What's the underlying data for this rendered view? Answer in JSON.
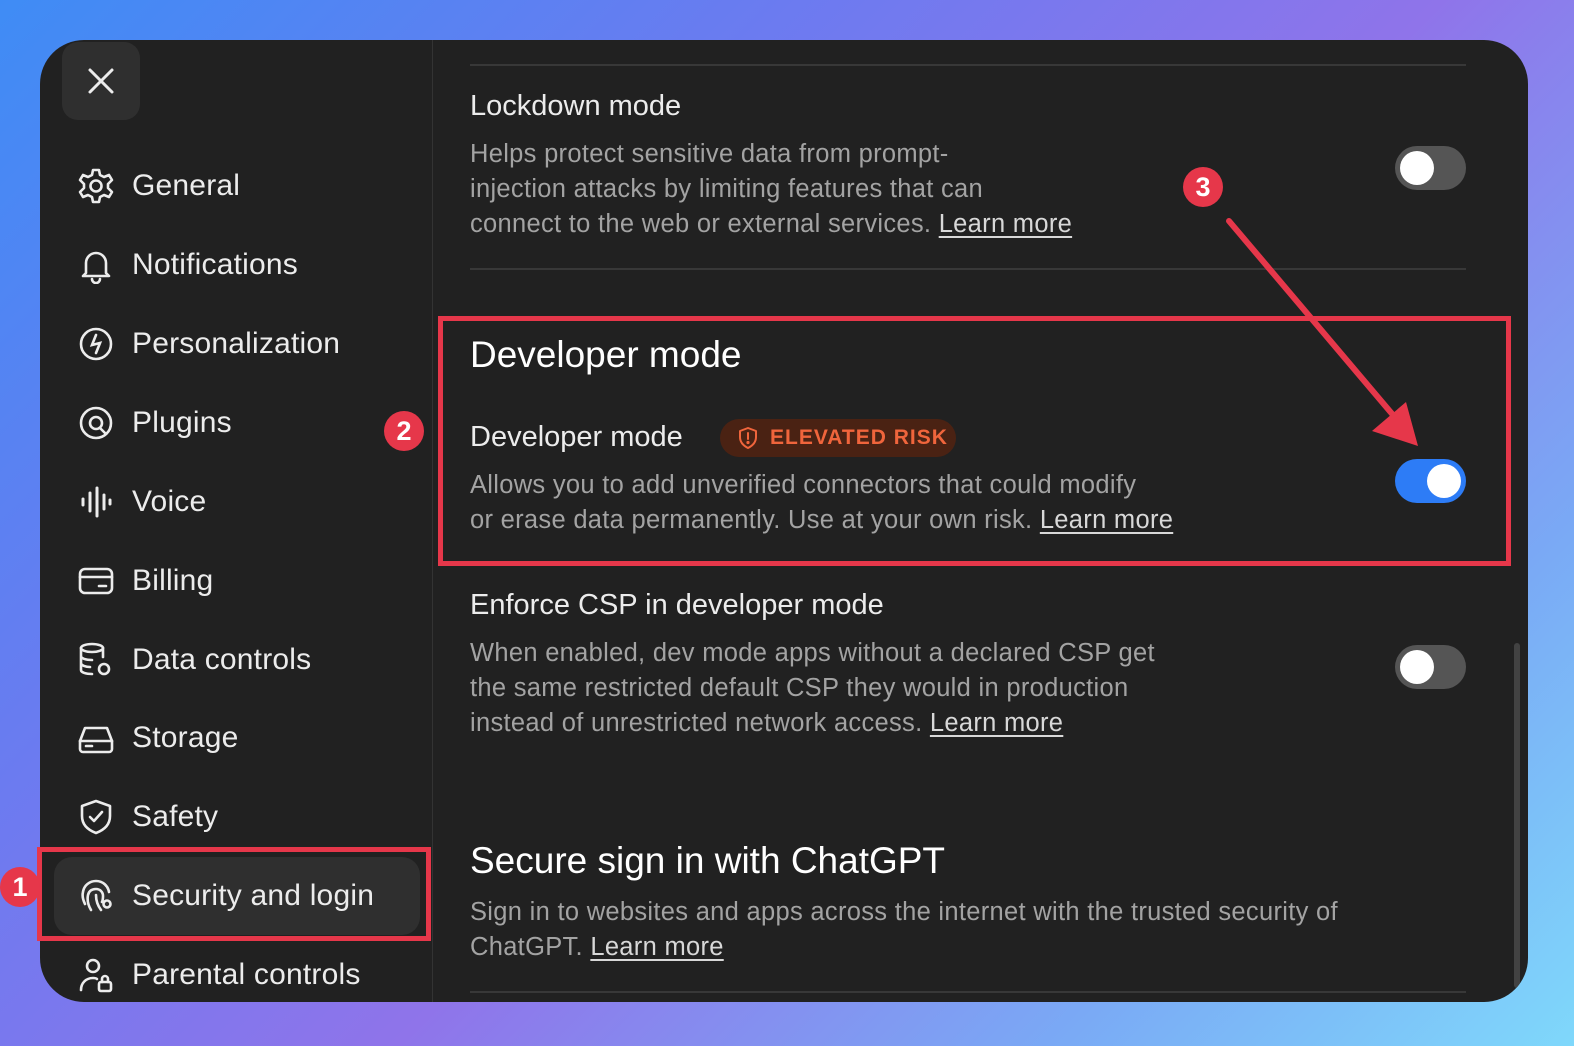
{
  "sidebar": {
    "close_label": "Close",
    "items": [
      {
        "label": "General",
        "icon": "gear-icon"
      },
      {
        "label": "Notifications",
        "icon": "bell-icon"
      },
      {
        "label": "Personalization",
        "icon": "personalization-icon"
      },
      {
        "label": "Plugins",
        "icon": "plugins-icon"
      },
      {
        "label": "Voice",
        "icon": "voice-waveform-icon"
      },
      {
        "label": "Billing",
        "icon": "credit-card-icon"
      },
      {
        "label": "Data controls",
        "icon": "database-gear-icon"
      },
      {
        "label": "Storage",
        "icon": "storage-drive-icon"
      },
      {
        "label": "Safety",
        "icon": "shield-check-icon"
      },
      {
        "label": "Security and login",
        "icon": "fingerprint-icon",
        "active": true
      },
      {
        "label": "Parental controls",
        "icon": "user-lock-icon"
      }
    ]
  },
  "content": {
    "lockdown": {
      "title": "Lockdown mode",
      "desc_line1": "Helps protect sensitive data from prompt-",
      "desc_line2": "injection attacks by limiting features that can",
      "desc_line3": "connect to the web or external services.",
      "link": "Learn more",
      "enabled": false
    },
    "developer_section": {
      "heading": "Developer mode",
      "row_title": "Developer mode",
      "badge": "ELEVATED RISK",
      "desc_line1": "Allows you to add unverified connectors that could modify",
      "desc_line2": "or erase data permanently. Use at your own risk.",
      "link": "Learn more",
      "enabled": true
    },
    "enforce_csp": {
      "title": "Enforce CSP in developer mode",
      "desc_line1": "When enabled, dev mode apps without a declared CSP get",
      "desc_line2": "the same restricted default CSP they would in production",
      "desc_line3": "instead of unrestricted network access.",
      "link": "Learn more",
      "enabled": false
    },
    "secure_signin": {
      "heading": "Secure sign in with ChatGPT",
      "desc_line1": "Sign in to websites and apps across the internet with the trusted security of",
      "desc_line2": "ChatGPT.",
      "link": "Learn more"
    }
  },
  "annotations": {
    "markers": [
      "1",
      "2",
      "3"
    ],
    "color": "#e6374a"
  },
  "colors": {
    "panel_bg": "#212121",
    "toggle_on": "#2d7cf6",
    "toggle_off": "#555555",
    "badge_bg": "#4a2213",
    "badge_text": "#f0653c"
  }
}
